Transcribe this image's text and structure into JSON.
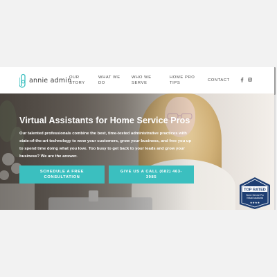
{
  "brand": {
    "name": "annie admin",
    "accent": "#3bbfbf"
  },
  "nav": {
    "items": [
      {
        "label": "OUR\nSTORY"
      },
      {
        "label": "WHAT WE\nDO"
      },
      {
        "label": "WHO WE\nSERVE"
      },
      {
        "label": "HOME PRO\nTIPS"
      },
      {
        "label": "CONTACT"
      }
    ],
    "social": [
      "facebook-icon",
      "instagram-icon"
    ]
  },
  "hero": {
    "title": "Virtual Assistants for Home Service Pros",
    "body": "Our talented professionals combine the best, time-tested administrative practices with state-of-the-art technology to wow your customers, grow your business, and free you up to spend time doing what you love. Too busy to get back to your leads and grow your business? We are the answer.",
    "cta_primary": "SCHEDULE A FREE CONSULTATION",
    "cta_secondary": "GIVE US A CALL (682) 463-3985"
  },
  "badge": {
    "title": "TOP RATED",
    "line1": "Home Service Pro",
    "line2": "Virtual Assistants"
  }
}
